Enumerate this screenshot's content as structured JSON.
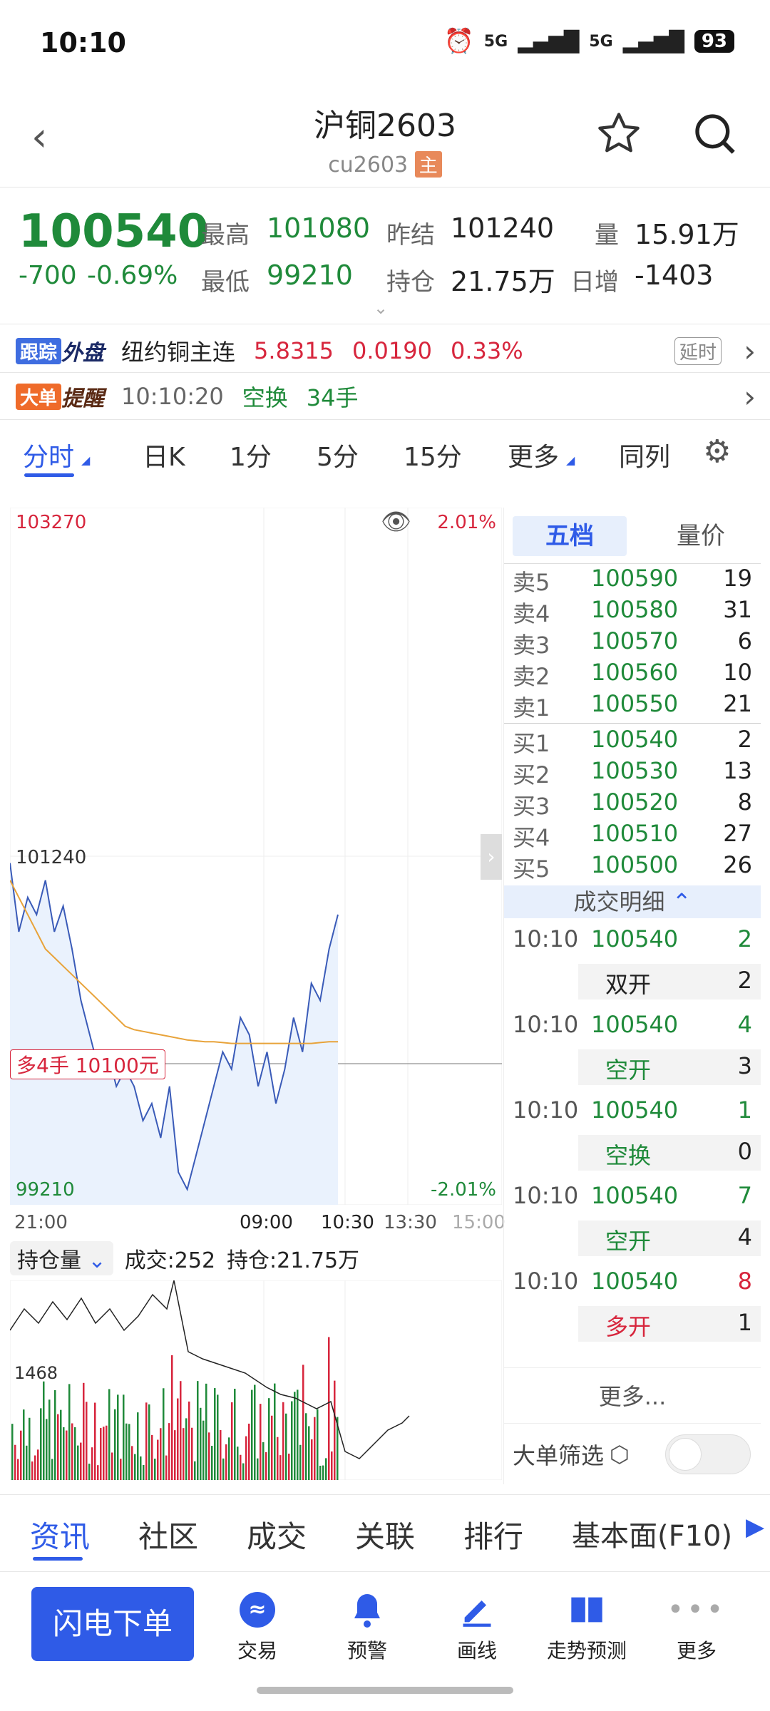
{
  "status": {
    "time": "10:10",
    "signal1": "5G",
    "signal2": "5G",
    "battery": "93"
  },
  "header": {
    "title": "沪铜2603",
    "code": "cu2603",
    "badge": "主"
  },
  "quote": {
    "price": "100540",
    "change": "-700",
    "pct": "-0.69%",
    "high_label": "最高",
    "high": "101080",
    "low_label": "最低",
    "low": "99210",
    "prev_label": "昨结",
    "prev": "101240",
    "oi_label": "持仓",
    "oi": "21.75万",
    "vol_label": "量",
    "vol": "15.91万",
    "inc_label": "日增",
    "inc": "-1403"
  },
  "tracker": {
    "tag1": "跟踪",
    "tag2": "外盘",
    "name": "纽约铜主连",
    "price": "5.8315",
    "chg": "0.0190",
    "pct": "0.33%",
    "delay": "延时"
  },
  "alert": {
    "tag1": "大单",
    "tag2": "提醒",
    "time": "10:10:20",
    "type": "空换",
    "qty": "34手"
  },
  "tabs": [
    "分时",
    "日K",
    "1分",
    "5分",
    "15分",
    "更多",
    "同列"
  ],
  "chart": {
    "top_price": "103270",
    "top_pct": "2.01%",
    "mid_price": "101240",
    "bottom_price": "99210",
    "bottom_pct": "-2.01%",
    "position_label": "多4手 10100元",
    "times": [
      "21:00",
      "09:00",
      "10:30",
      "13:30",
      "15:00"
    ],
    "sub_label": "持仓量",
    "sub_vol": "成交:252",
    "sub_oi": "持仓:21.75万",
    "sub_axis": "1468"
  },
  "chart_data": {
    "type": "line",
    "title": "",
    "ylim": [
      99210,
      103270
    ],
    "series": [
      {
        "name": "price",
        "values": [
          101200,
          100800,
          101000,
          100900,
          101100,
          100800,
          100950,
          100700,
          100400,
          100200,
          100000,
          100100,
          99900,
          100000,
          99900,
          99700,
          99800,
          99600,
          99900,
          99400,
          99300,
          99500,
          99700,
          99900,
          100100,
          100000,
          100300,
          100200,
          99900,
          100100,
          99800,
          100000,
          100300,
          100100,
          100500,
          100400,
          100700,
          100900
        ]
      },
      {
        "name": "avg",
        "values": [
          101100,
          101000,
          100900,
          100800,
          100700,
          100650,
          100600,
          100550,
          100500,
          100450,
          100400,
          100350,
          100300,
          100250,
          100230,
          100220,
          100210,
          100200,
          100190,
          100180,
          100170,
          100165,
          100160,
          100160,
          100155,
          100150,
          100150,
          100150,
          100150,
          100150,
          100150,
          100150,
          100150,
          100150,
          100150,
          100155,
          100160,
          100160
        ]
      }
    ]
  },
  "orderbook": {
    "tab1": "五档",
    "tab2": "量价",
    "asks": [
      {
        "label": "卖5",
        "price": "100590",
        "qty": "19"
      },
      {
        "label": "卖4",
        "price": "100580",
        "qty": "31"
      },
      {
        "label": "卖3",
        "price": "100570",
        "qty": "6"
      },
      {
        "label": "卖2",
        "price": "100560",
        "qty": "10"
      },
      {
        "label": "卖1",
        "price": "100550",
        "qty": "21"
      }
    ],
    "bids": [
      {
        "label": "买1",
        "price": "100540",
        "qty": "2"
      },
      {
        "label": "买2",
        "price": "100530",
        "qty": "13"
      },
      {
        "label": "买3",
        "price": "100520",
        "qty": "8"
      },
      {
        "label": "买4",
        "price": "100510",
        "qty": "27"
      },
      {
        "label": "买5",
        "price": "100500",
        "qty": "26"
      }
    ],
    "detail_title": "成交明细",
    "deals": [
      {
        "time": "10:10",
        "price": "100540",
        "qty": "2",
        "type": "双开",
        "n": "2"
      },
      {
        "time": "10:10",
        "price": "100540",
        "qty": "4",
        "type": "空开",
        "n": "3"
      },
      {
        "time": "10:10",
        "price": "100540",
        "qty": "1",
        "type": "空换",
        "n": "0"
      },
      {
        "time": "10:10",
        "price": "100540",
        "qty": "7",
        "type": "空开",
        "n": "4"
      },
      {
        "time": "10:10",
        "price": "100540",
        "qty": "8",
        "type": "多开",
        "n": "1"
      }
    ],
    "more": "更多...",
    "filter": "大单筛选"
  },
  "bottom_tabs": [
    "资讯",
    "社区",
    "成交",
    "关联",
    "排行",
    "基本面(F10)"
  ],
  "dock": {
    "main": "闪电下单",
    "items": [
      "交易",
      "预警",
      "画线",
      "走势预测",
      "更多"
    ]
  },
  "colors": {
    "blue": "#2f5be7",
    "red": "#d7263d",
    "green": "#1f8a3a",
    "orange": "#e8a33a"
  }
}
